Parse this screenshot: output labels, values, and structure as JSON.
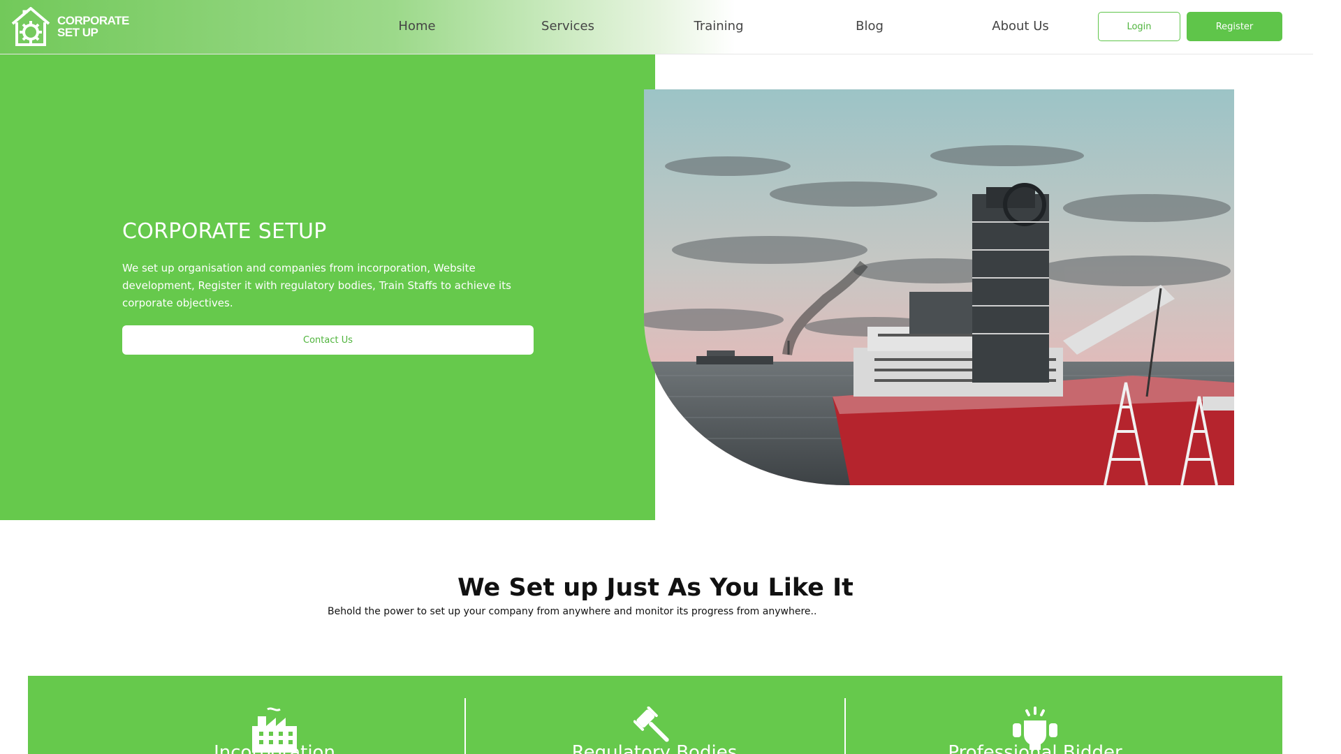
{
  "brand": {
    "line1": "CORPORATE",
    "line2": "SET UP"
  },
  "nav": {
    "links": [
      "Home",
      "Services",
      "Training",
      "Blog",
      "About Us"
    ],
    "login": "Login",
    "register": "Register"
  },
  "hero": {
    "title": "CORPORATE SETUP",
    "description": "We set up organisation and companies from incorporation, Website development, Register it with regulatory bodies, Train Staffs to achieve its corporate objectives.",
    "cta": "Contact Us",
    "image": "offshore-vessel-photo"
  },
  "section": {
    "title": "We Set up Just As You Like It",
    "subtitle": "Behold the power to set up your company from anywhere and monitor its progress from anywhere.."
  },
  "features": [
    {
      "label": "Incorporation",
      "icon": "factory-icon"
    },
    {
      "label": "Regulatory Bodies",
      "icon": "gavel-icon"
    },
    {
      "label": "Professional Bidder",
      "icon": "bidder-icon"
    }
  ],
  "colors": {
    "primary": "#66c94c",
    "button": "#5fc54a",
    "text": "#444444"
  }
}
